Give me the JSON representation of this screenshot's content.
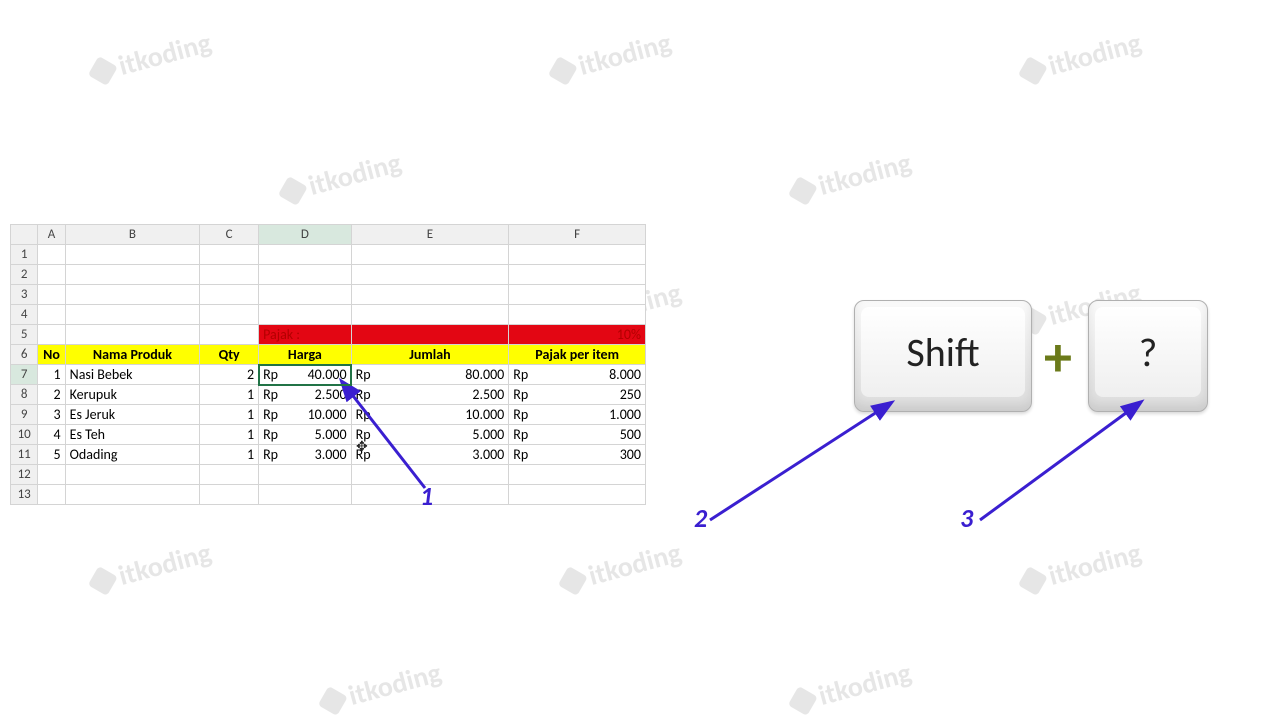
{
  "columns": [
    "A",
    "B",
    "C",
    "D",
    "E",
    "F"
  ],
  "row_numbers": [
    "1",
    "2",
    "3",
    "4",
    "5",
    "6",
    "7",
    "8",
    "9",
    "10",
    "11",
    "12",
    "13"
  ],
  "pajak": {
    "label": "Pajak :",
    "value": "10%"
  },
  "headers": {
    "no": "No",
    "nama": "Nama Produk",
    "qty": "Qty",
    "harga": "Harga",
    "jumlah": "Jumlah",
    "pajak_item": "Pajak per item"
  },
  "rows": [
    {
      "no": "1",
      "nama": "Nasi Bebek",
      "qty": "2",
      "harga": "40.000",
      "jumlah": "80.000",
      "pajak": "8.000"
    },
    {
      "no": "2",
      "nama": "Kerupuk",
      "qty": "1",
      "harga": "2.500",
      "jumlah": "2.500",
      "pajak": "250"
    },
    {
      "no": "3",
      "nama": "Es Jeruk",
      "qty": "1",
      "harga": "10.000",
      "jumlah": "10.000",
      "pajak": "1.000"
    },
    {
      "no": "4",
      "nama": "Es Teh",
      "qty": "1",
      "harga": "5.000",
      "jumlah": "5.000",
      "pajak": "500"
    },
    {
      "no": "5",
      "nama": "Odading",
      "qty": "1",
      "harga": "3.000",
      "jumlah": "3.000",
      "pajak": "300"
    }
  ],
  "currency": "Rp",
  "keys": {
    "shift": "Shift",
    "second": "?"
  },
  "plus": "+",
  "callouts": {
    "c1": "1",
    "c2": "2",
    "c3": "3"
  },
  "watermark": "itkoding",
  "chart_data": {
    "type": "table",
    "title": "",
    "columns": [
      "No",
      "Nama Produk",
      "Qty",
      "Harga",
      "Jumlah",
      "Pajak per item"
    ],
    "pajak_rate": "10%",
    "rows": [
      [
        1,
        "Nasi Bebek",
        2,
        40000,
        80000,
        8000
      ],
      [
        2,
        "Kerupuk",
        1,
        2500,
        2500,
        250
      ],
      [
        3,
        "Es Jeruk",
        1,
        10000,
        10000,
        1000
      ],
      [
        4,
        "Es Teh",
        1,
        5000,
        5000,
        500
      ],
      [
        5,
        "Odading",
        1,
        3000,
        3000,
        300
      ]
    ]
  }
}
